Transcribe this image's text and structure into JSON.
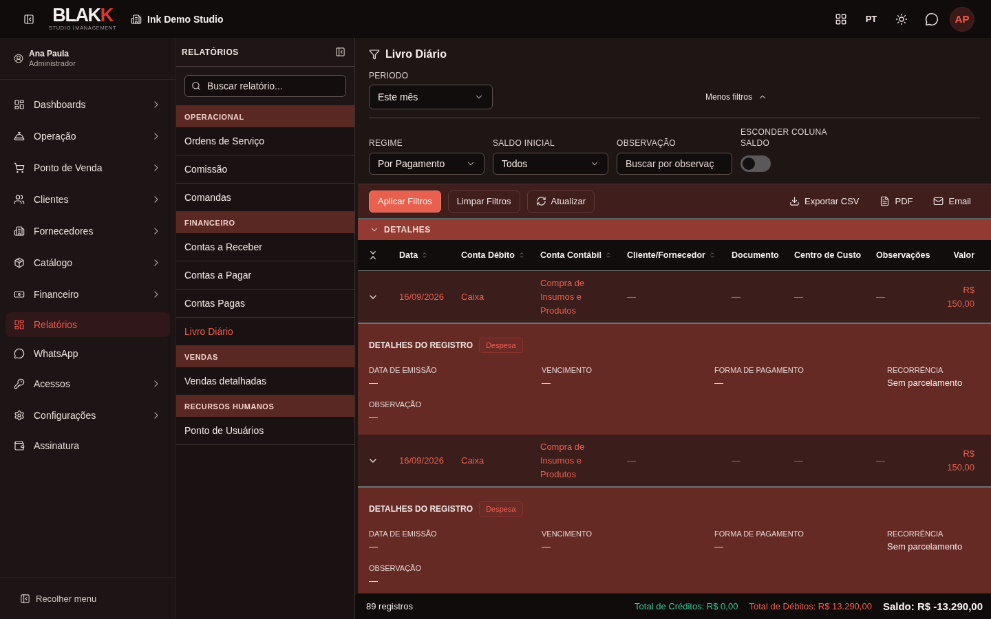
{
  "topbar": {
    "logo": {
      "name": "BLAK",
      "name_accent": "K",
      "tagline": [
        "STUDIO",
        "MANAGEMENT"
      ]
    },
    "studio": "Ink Demo Studio",
    "language": "PT",
    "avatar": "AP"
  },
  "sidebar": {
    "user": {
      "name": "Ana Paula",
      "role": "Administrador"
    },
    "items": [
      {
        "label": "Dashboards",
        "selected": false,
        "has_submenu": true
      },
      {
        "label": "Operação",
        "selected": false,
        "has_submenu": true
      },
      {
        "label": "Ponto de Venda",
        "selected": false,
        "has_submenu": true
      },
      {
        "label": "Clientes",
        "selected": false,
        "has_submenu": true
      },
      {
        "label": "Fornecedores",
        "selected": false,
        "has_submenu": true
      },
      {
        "label": "Catálogo",
        "selected": false,
        "has_submenu": true
      },
      {
        "label": "Financeiro",
        "selected": false,
        "has_submenu": true
      },
      {
        "label": "Relatórios",
        "selected": true,
        "has_submenu": false
      },
      {
        "label": "WhatsApp",
        "selected": false,
        "has_submenu": false
      },
      {
        "label": "Acessos",
        "selected": false,
        "has_submenu": true
      },
      {
        "label": "Configurações",
        "selected": false,
        "has_submenu": true
      },
      {
        "label": "Assinatura",
        "selected": false,
        "has_submenu": false
      }
    ],
    "collapse_label": "Recolher menu"
  },
  "reports_panel": {
    "title": "RELATÓRIOS",
    "search": {
      "placeholder": "Buscar relatório..."
    },
    "sections": [
      {
        "title": "OPERACIONAL",
        "items": [
          {
            "label": "Ordens de Serviço",
            "selected": false
          },
          {
            "label": "Comissão",
            "selected": false
          },
          {
            "label": "Comandas",
            "selected": false
          }
        ]
      },
      {
        "title": "FINANCEIRO",
        "items": [
          {
            "label": "Contas a Receber",
            "selected": false
          },
          {
            "label": "Contas a Pagar",
            "selected": false
          },
          {
            "label": "Contas Pagas",
            "selected": false
          },
          {
            "label": "Livro Diário",
            "selected": true
          }
        ]
      },
      {
        "title": "VENDAS",
        "items": [
          {
            "label": "Vendas detalhadas",
            "selected": false
          }
        ]
      },
      {
        "title": "RECURSOS HUMANOS",
        "items": [
          {
            "label": "Ponto de Usuários",
            "selected": false
          }
        ]
      }
    ]
  },
  "main": {
    "title": "Livro Diário",
    "period": {
      "label": "PERIODO",
      "value": "Este mês"
    },
    "more_filters": {
      "label": "Menos filtros",
      "expanded": true
    },
    "filters": [
      {
        "kind": "select",
        "label": "REGIME",
        "value": "Por Pagamento"
      },
      {
        "kind": "select",
        "label": "SALDO INICIAL",
        "value": "Todos"
      },
      {
        "kind": "text",
        "label": "OBSERVAÇÃO",
        "placeholder": "Buscar por observaç"
      },
      {
        "kind": "toggle",
        "label": "ESCONDER COLUNA SALDO",
        "on": false
      }
    ],
    "actions": [
      {
        "label": "Aplicar Filtros",
        "kind": "primary"
      },
      {
        "label": "Limpar Filtros",
        "kind": "outline"
      },
      {
        "label": "Atualizar",
        "kind": "outline"
      }
    ],
    "exports": [
      "Exportar CSV",
      "PDF",
      "Email"
    ],
    "section": {
      "title": "DETALHES",
      "expanded": true
    },
    "table": {
      "columns": [
        {
          "label": "Data",
          "sortable": true
        },
        {
          "label": "Conta Débito",
          "sortable": true
        },
        {
          "label": "Conta Contábil",
          "sortable": true
        },
        {
          "label": "Cliente/Fornecedor",
          "sortable": true
        },
        {
          "label": "Documento",
          "sortable": false
        },
        {
          "label": "Centro de Custo",
          "sortable": false
        },
        {
          "label": "Observações",
          "sortable": false
        },
        {
          "label": "Valor",
          "sortable": false
        }
      ],
      "rows": [
        {
          "cells": [
            "16/09/2026",
            "Caixa",
            "Compra de Insumos e Produtos",
            "—",
            "—",
            "—",
            "—",
            "R$ 150,00"
          ],
          "expanded": true,
          "details": {
            "title": "DETALHES DO REGISTRO",
            "badge": "Despesa",
            "fields": [
              {
                "label": "DATA DE EMISSÃO",
                "value": "—"
              },
              {
                "label": "VENCIMENTO",
                "value": "—"
              },
              {
                "label": "FORMA DE PAGAMENTO",
                "value": "—"
              },
              {
                "label": "RECORRÊNCIA",
                "value": "Sem parcelamento"
              },
              {
                "label": "OBSERVAÇÃO",
                "value": "—"
              }
            ]
          }
        },
        {
          "cells": [
            "16/09/2026",
            "Caixa",
            "Compra de Insumos e Produtos",
            "—",
            "—",
            "—",
            "—",
            "R$ 150,00"
          ],
          "expanded": true,
          "details": {
            "title": "DETALHES DO REGISTRO",
            "badge": "Despesa",
            "fields": [
              {
                "label": "DATA DE EMISSÃO",
                "value": "—"
              },
              {
                "label": "VENCIMENTO",
                "value": "—"
              },
              {
                "label": "FORMA DE PAGAMENTO",
                "value": "—"
              },
              {
                "label": "RECORRÊNCIA",
                "value": "Sem parcelamento"
              },
              {
                "label": "OBSERVAÇÃO",
                "value": "—"
              }
            ]
          }
        }
      ]
    },
    "footer": {
      "count": "89 registros",
      "credits": "Total de Créditos: R$ 0,00",
      "debits": "Total de Débitos: R$ 13.290,00",
      "balance": "Saldo: R$ -13.290,00"
    }
  }
}
